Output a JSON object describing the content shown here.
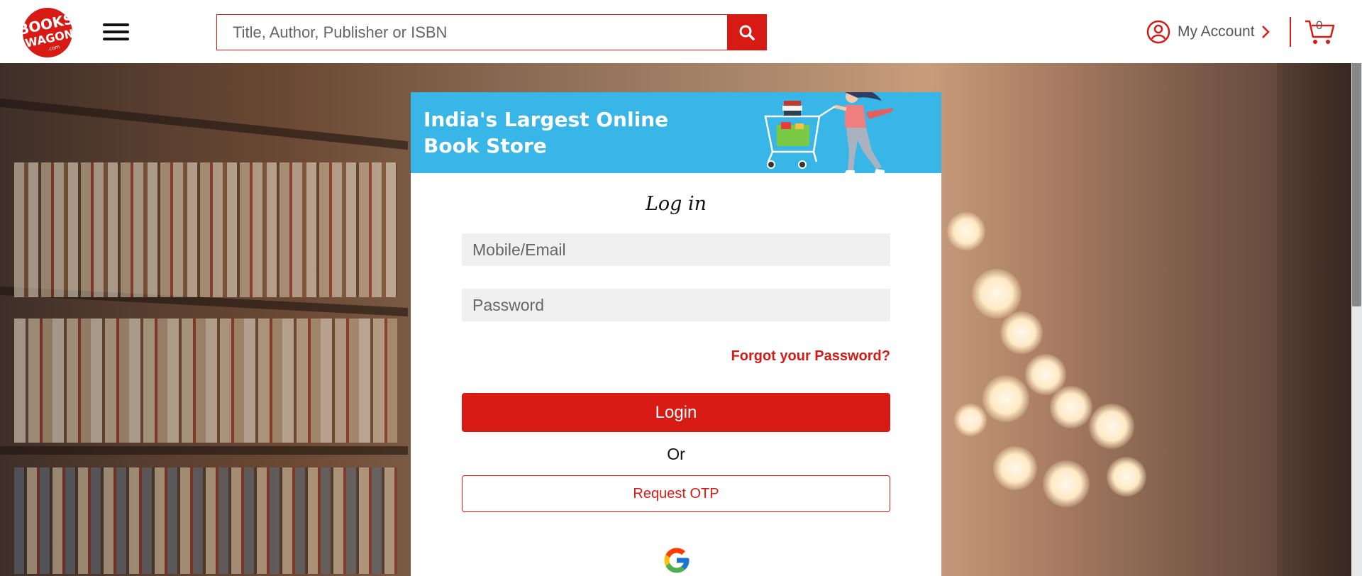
{
  "header": {
    "logo_alt": "BOOKSWAGON",
    "search_placeholder": "Title, Author, Publisher or ISBN",
    "account_label": "My Account",
    "cart_count": "0"
  },
  "banner": {
    "line1": "India's Largest Online",
    "line2": "Book Store"
  },
  "login": {
    "title": "Log in",
    "mobile_placeholder": "Mobile/Email",
    "password_placeholder": "Password",
    "forgot_label": "Forgot your Password?",
    "login_label": "Login",
    "or_label": "Or",
    "otp_label": "Request OTP"
  },
  "colors": {
    "brand_red": "#d71a14",
    "banner_blue": "#39b6e8"
  },
  "icons": [
    "bookswagon-logo",
    "hamburger-icon",
    "search-icon",
    "user-circle-icon",
    "chevron-right-icon",
    "cart-icon",
    "google-icon"
  ]
}
